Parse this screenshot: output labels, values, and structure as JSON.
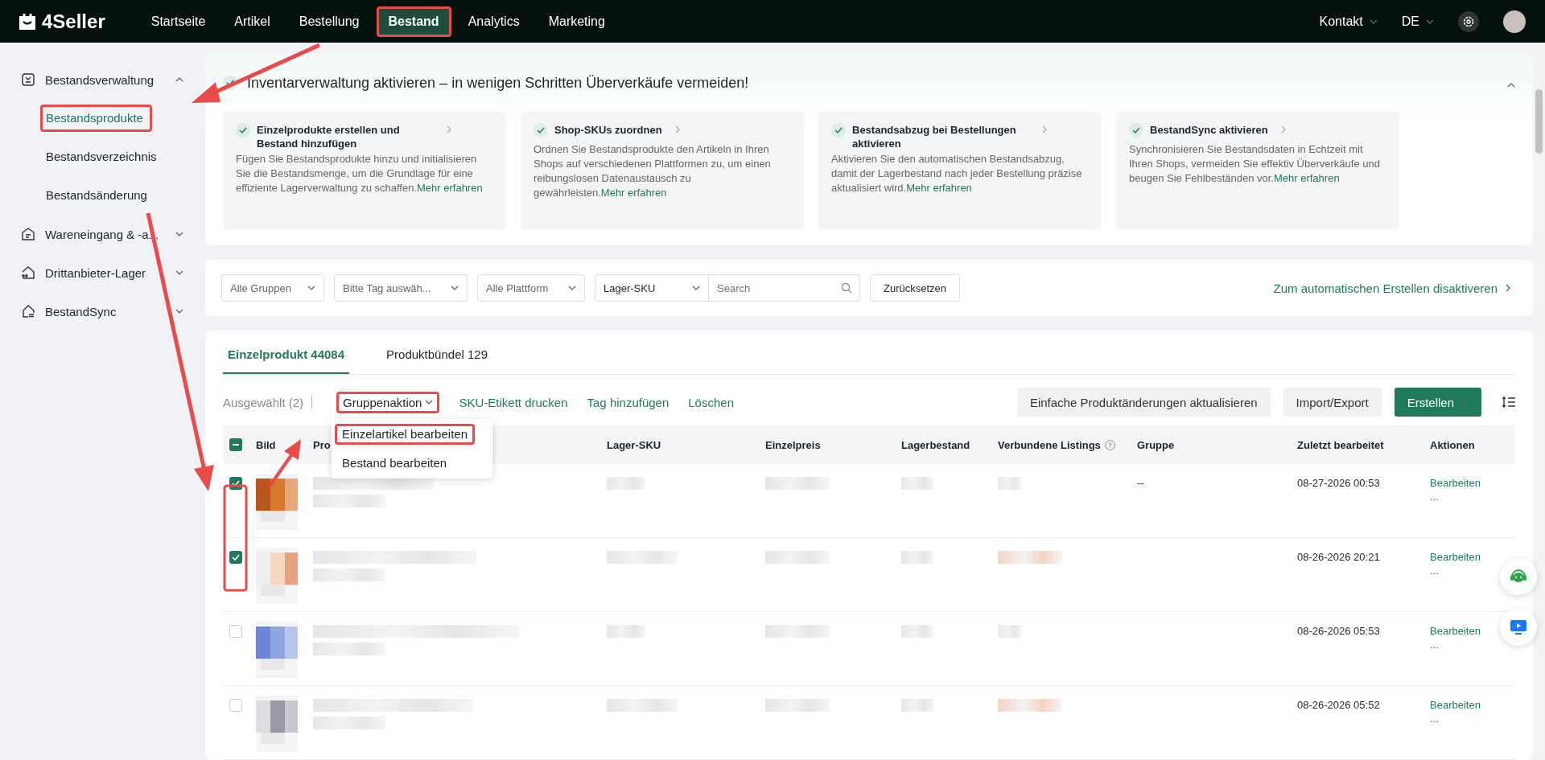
{
  "app": {
    "logo": "4Seller"
  },
  "nav": [
    {
      "label": "Startseite",
      "selected": false,
      "highlighted": false
    },
    {
      "label": "Artikel",
      "selected": false,
      "highlighted": false
    },
    {
      "label": "Bestellung",
      "selected": false,
      "highlighted": false
    },
    {
      "label": "Bestand",
      "selected": true,
      "highlighted": true
    },
    {
      "label": "Analytics",
      "selected": false,
      "highlighted": false
    },
    {
      "label": "Marketing",
      "selected": false,
      "highlighted": false
    }
  ],
  "header_right": {
    "contact": "Kontakt",
    "language": "DE"
  },
  "sidebar": [
    {
      "label": "Bestandsverwaltung",
      "expanded": true,
      "children": [
        {
          "label": "Bestandsprodukte",
          "selected": true,
          "highlighted": true
        },
        {
          "label": "Bestandsverzeichnis",
          "selected": false,
          "highlighted": false
        },
        {
          "label": "Bestandsänderung",
          "selected": false,
          "highlighted": false
        }
      ]
    },
    {
      "label": "Wareneingang & -a...",
      "expanded": false
    },
    {
      "label": "Drittanbieter-Lager",
      "expanded": false
    },
    {
      "label": "BestandSync",
      "expanded": false
    }
  ],
  "banner": {
    "title": "Inventarverwaltung aktivieren – in wenigen Schritten Überverkäufe vermeiden!",
    "expanded": true,
    "steps": [
      {
        "title": "Einzelprodukte erstellen und Bestand hinzufügen",
        "done": true,
        "body": "Fügen Sie Bestandsprodukte hinzu und initialisieren Sie die Bestandsmenge, um die Grundlage für eine effiziente Lagerverwaltung zu schaffen.",
        "link": "Mehr erfahren"
      },
      {
        "title": "Shop-SKUs zuordnen",
        "done": true,
        "body": "Ordnen Sie Bestandsprodukte den Artikeln in Ihren Shops auf verschiedenen Plattformen zu, um einen reibungslosen Datenaustausch zu gewährleisten.",
        "link": "Mehr erfahren"
      },
      {
        "title": "Bestandsabzug bei Bestellungen aktivieren",
        "done": true,
        "body": "Aktivieren Sie den automatischen Bestandsabzug, damit der Lagerbestand nach jeder Bestellung präzise aktualisiert wird.",
        "link": "Mehr erfahren"
      },
      {
        "title": "BestandSync aktivieren",
        "done": true,
        "body": "Synchronisieren Sie Bestandsdaten in Echtzeit mit Ihren Shops, vermeiden Sie effektiv Überverkäufe und beugen Sie Fehlbeständen vor.",
        "link": "Mehr erfahren"
      }
    ]
  },
  "filters": {
    "group": "Alle Gruppen",
    "tag": "Bitte Tag auswäh...",
    "platform": "Alle Plattform",
    "search_type": "Lager-SKU",
    "search_placeholder": "Search",
    "reset": "Zurücksetzen",
    "auto_link": "Zum automatischen Erstellen disaktiveren"
  },
  "tabs": [
    {
      "label": "Einzelprodukt 44084",
      "selected": true
    },
    {
      "label": "Produktbündel 129",
      "selected": false
    }
  ],
  "toolbar": {
    "selected_count": "Ausgewählt (2)",
    "actions": [
      {
        "label": "Gruppenaktion",
        "kind": "dropdown",
        "highlighted": true
      },
      {
        "label": "SKU-Etikett drucken",
        "kind": "link"
      },
      {
        "label": "Tag hinzufügen",
        "kind": "link"
      },
      {
        "label": "Löschen",
        "kind": "link"
      }
    ],
    "buttons": [
      {
        "label": "Einfache Produktänderungen aktualisieren",
        "kind": "secondary"
      },
      {
        "label": "Import/Export",
        "kind": "secondary"
      },
      {
        "label": "Erstellen",
        "kind": "primary"
      }
    ]
  },
  "dropdown_menu": [
    {
      "label": "Einzelartikel bearbeiten",
      "highlighted": true
    },
    {
      "label": "Bestand bearbeiten",
      "highlighted": false
    }
  ],
  "table": {
    "header_indeterminate": true,
    "columns": [
      {
        "label": "Bild"
      },
      {
        "label": "Pro"
      },
      {
        "label": "Lager-SKU"
      },
      {
        "label": "Einzelpreis"
      },
      {
        "label": "Lagerbestand"
      },
      {
        "label": "Verbundene Listings",
        "help": true
      },
      {
        "label": "Gruppe"
      },
      {
        "label": "Zuletzt bearbeitet"
      },
      {
        "label": "Aktionen"
      }
    ],
    "rows": [
      {
        "checked": true,
        "group": "--",
        "edited": "08-27-2026 00:53",
        "action": "Bearbeiten",
        "more": "..."
      },
      {
        "checked": true,
        "edited": "08-26-2026 20:21",
        "action": "Bearbeiten",
        "more": "..."
      },
      {
        "checked": false,
        "edited": "08-26-2026 05:53",
        "action": "Bearbeiten",
        "more": "..."
      },
      {
        "checked": false,
        "edited": "08-26-2026 05:52",
        "action": "Bearbeiten",
        "more": "..."
      }
    ]
  }
}
